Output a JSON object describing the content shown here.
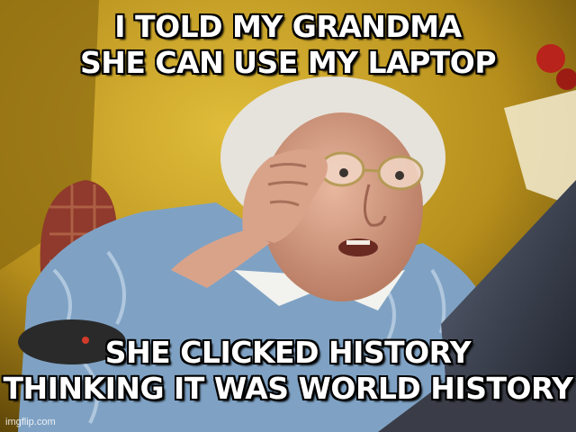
{
  "meme": {
    "top_text": [
      "I TOLD MY GRANDMA",
      "SHE CAN USE MY LAPTOP"
    ],
    "bottom_text": [
      "SHE CLICKED HISTORY",
      "THINKING IT WAS WORLD HISTORY"
    ],
    "watermark": "imgflip.com"
  },
  "colors": {
    "wall": "#c9a227",
    "sweater": "#7fa2c4",
    "skin": "#d9a38a",
    "hair": "#e6e3dc",
    "laptop": "#2f3340",
    "text": "#ffffff",
    "outline": "#000000"
  }
}
